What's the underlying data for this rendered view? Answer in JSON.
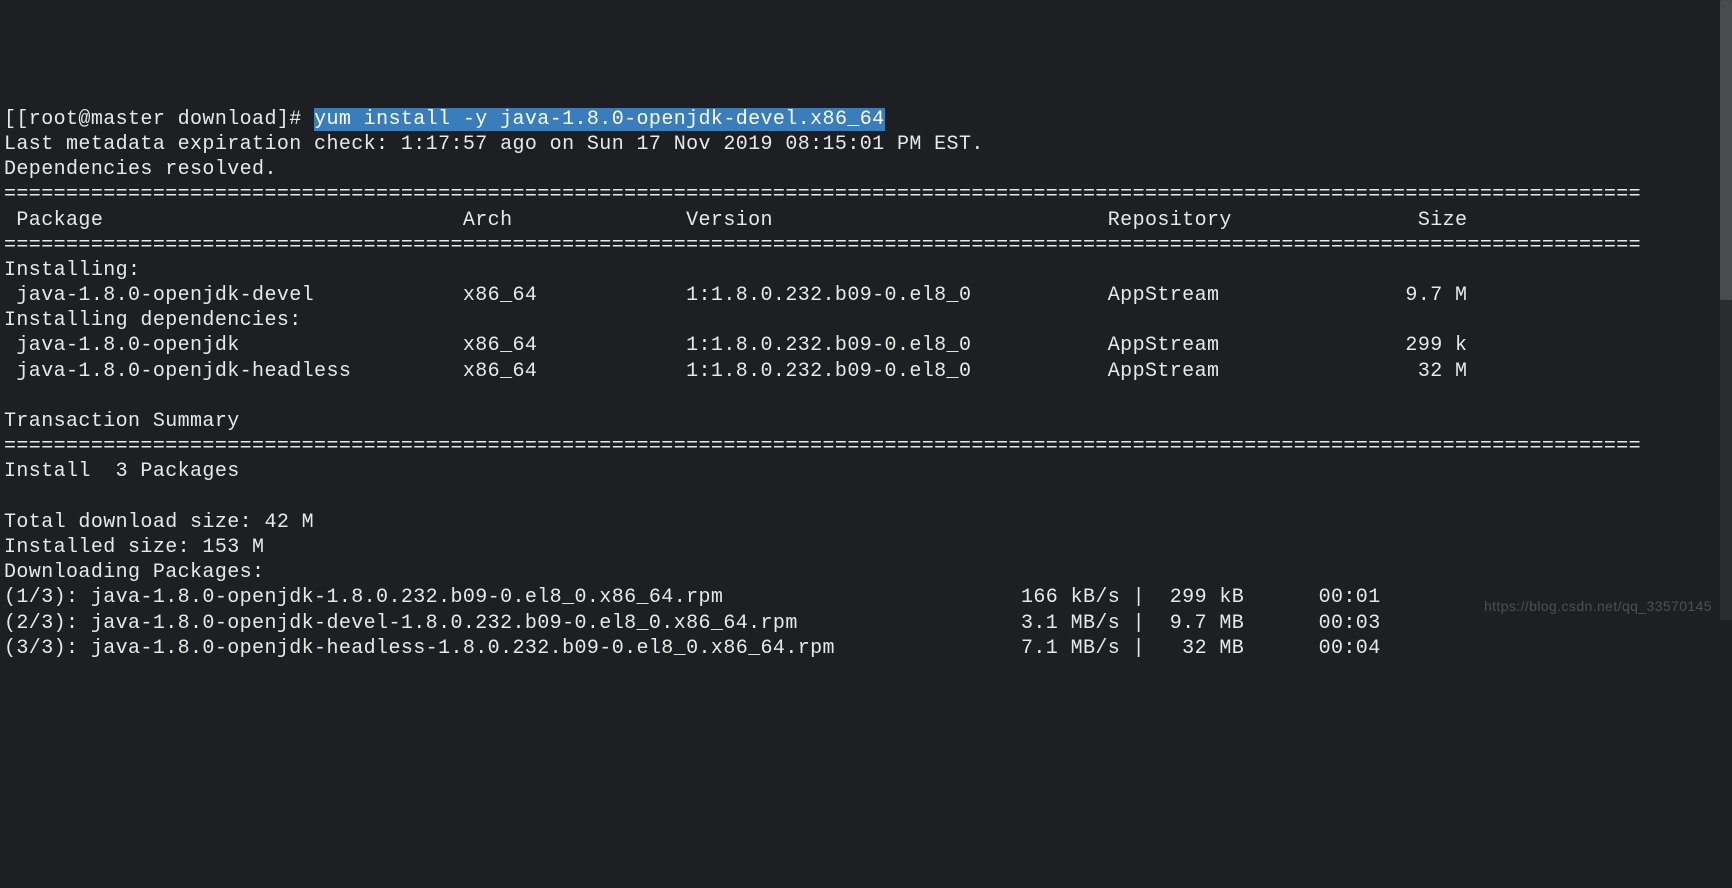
{
  "prompt": {
    "prefix": "[[root@master download]# ",
    "command": "yum install -y java-1.8.0-openjdk-devel.x86_64"
  },
  "metadata_line": "Last metadata expiration check: 1:17:57 ago on Sun 17 Nov 2019 08:15:01 PM EST.",
  "deps_resolved": "Dependencies resolved.",
  "divider": "====================================================================================================================================",
  "header": {
    "package": " Package",
    "arch": "Arch",
    "version": "Version",
    "repository": "Repository",
    "size": "Size"
  },
  "sections": {
    "installing": "Installing:",
    "installing_deps": "Installing dependencies:"
  },
  "packages": [
    {
      "name": " java-1.8.0-openjdk-devel",
      "arch": "x86_64",
      "version": "1:1.8.0.232.b09-0.el8_0",
      "repo": "AppStream",
      "size": "9.7 M"
    },
    {
      "name": " java-1.8.0-openjdk",
      "arch": "x86_64",
      "version": "1:1.8.0.232.b09-0.el8_0",
      "repo": "AppStream",
      "size": "299 k"
    },
    {
      "name": " java-1.8.0-openjdk-headless",
      "arch": "x86_64",
      "version": "1:1.8.0.232.b09-0.el8_0",
      "repo": "AppStream",
      "size": " 32 M"
    }
  ],
  "transaction_summary": "Transaction Summary",
  "install_count": "Install  3 Packages",
  "total_download": "Total download size: 42 M",
  "installed_size": "Installed size: 153 M",
  "downloading": "Downloading Packages:",
  "downloads": [
    {
      "idx": "(1/3): ",
      "file": "java-1.8.0-openjdk-1.8.0.232.b09-0.el8_0.x86_64.rpm",
      "speed": "166 kB/s",
      "size": "299 kB",
      "time": "00:01"
    },
    {
      "idx": "(2/3): ",
      "file": "java-1.8.0-openjdk-devel-1.8.0.232.b09-0.el8_0.x86_64.rpm",
      "speed": "3.1 MB/s",
      "size": "9.7 MB",
      "time": "00:03"
    },
    {
      "idx": "(3/3): ",
      "file": "java-1.8.0-openjdk-headless-1.8.0.232.b09-0.el8_0.x86_64.rpm",
      "speed": "7.1 MB/s",
      "size": " 32 MB",
      "time": "00:04"
    }
  ],
  "watermark": "https://blog.csdn.net/qq_33570145",
  "cols": {
    "name_w": 37,
    "arch_w": 18,
    "version_w": 34,
    "repo_w": 19,
    "size_w": 10,
    "dl_left_w": 82,
    "speed_w": 8,
    "sep": " | ",
    "size_dl_w": 7,
    "gap": "     ",
    "time_w": 6
  }
}
